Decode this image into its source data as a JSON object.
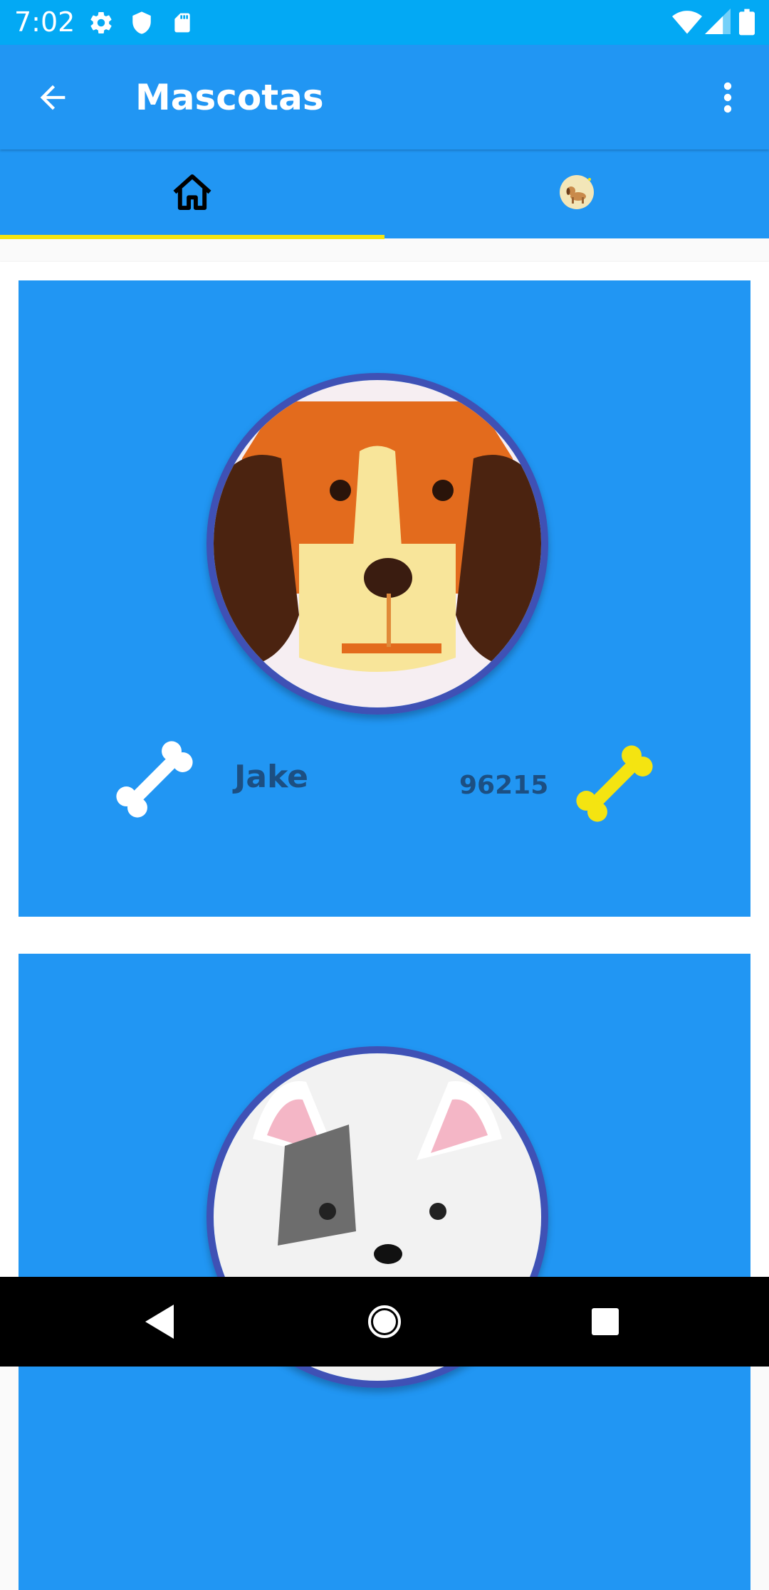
{
  "status_bar": {
    "time": "7:02",
    "left_icons": [
      "settings-icon",
      "shield-icon",
      "sd-card-icon"
    ],
    "right_icons": [
      "wifi-icon",
      "signal-icon",
      "battery-icon"
    ]
  },
  "app_bar": {
    "title": "Mascotas",
    "back_icon": "arrow-back-icon",
    "menu_icon": "more-vert-icon"
  },
  "tabs": [
    {
      "icon": "home-icon",
      "selected": true
    },
    {
      "icon": "dog-profile-icon",
      "selected": false
    }
  ],
  "pets": [
    {
      "name": "Jake",
      "likes": "96215",
      "avatar": "beagle-avatar"
    },
    {
      "name": "",
      "likes": "",
      "avatar": "white-dog-avatar"
    }
  ],
  "colors": {
    "status_bar": "#03a9f4",
    "primary": "#2196f3",
    "tab_indicator": "#f4e411",
    "avatar_border": "#3f51b5",
    "text_dark": "#1c4f82",
    "bone_white": "#ffffff",
    "bone_yellow": "#f4e411"
  },
  "nav_bar": {
    "buttons": [
      "back-triangle-icon",
      "home-circle-icon",
      "recents-square-icon"
    ]
  }
}
